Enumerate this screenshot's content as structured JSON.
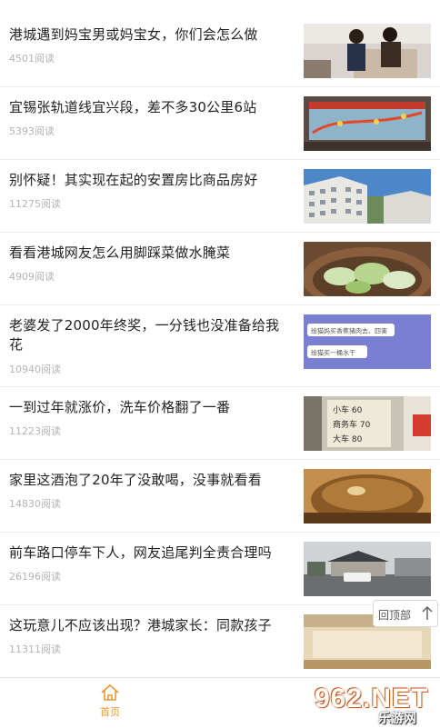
{
  "feed": {
    "items": [
      {
        "title": "港城遇到妈宝男或妈宝女，你们会怎么做",
        "reads": "4501阅读"
      },
      {
        "title": "宜锡张轨道线宜兴段，差不多30公里6站",
        "reads": "5393阅读"
      },
      {
        "title": "别怀疑！其实现在起的安置房比商品房好",
        "reads": "11275阅读"
      },
      {
        "title": "看看港城网友怎么用脚踩菜做水腌菜",
        "reads": "4909阅读"
      },
      {
        "title": "老婆发了2000年终奖，一分钱也没准备给我花",
        "reads": "10940阅读"
      },
      {
        "title": "一到过年就涨价，洗车价格翻了一番",
        "reads": "11223阅读"
      },
      {
        "title": "家里这酒泡了20年了没敢喝，没事就看看",
        "reads": "14830阅读"
      },
      {
        "title": "前车路口停车下人，网友追尾判全责合理吗",
        "reads": "26196阅读"
      },
      {
        "title": "这玩意儿不应该出现？港城家长：同款孩子",
        "reads": "11311阅读"
      }
    ]
  },
  "thumb5": {
    "line1": "给猫妈买香蕉猪肉去、四害",
    "line2": "给猫买一桶水干"
  },
  "thumb6": {
    "line1": "小车 60",
    "line2": "商务车 70",
    "line3": "大车 80"
  },
  "tabbar": {
    "home_label": "首页"
  },
  "back_to_top": {
    "label": "回顶部"
  },
  "watermark": {
    "main": "962.NET",
    "sub": "乐游网"
  },
  "colors": {
    "accent": "#e69a2e",
    "reads": "#b4b4b4"
  }
}
